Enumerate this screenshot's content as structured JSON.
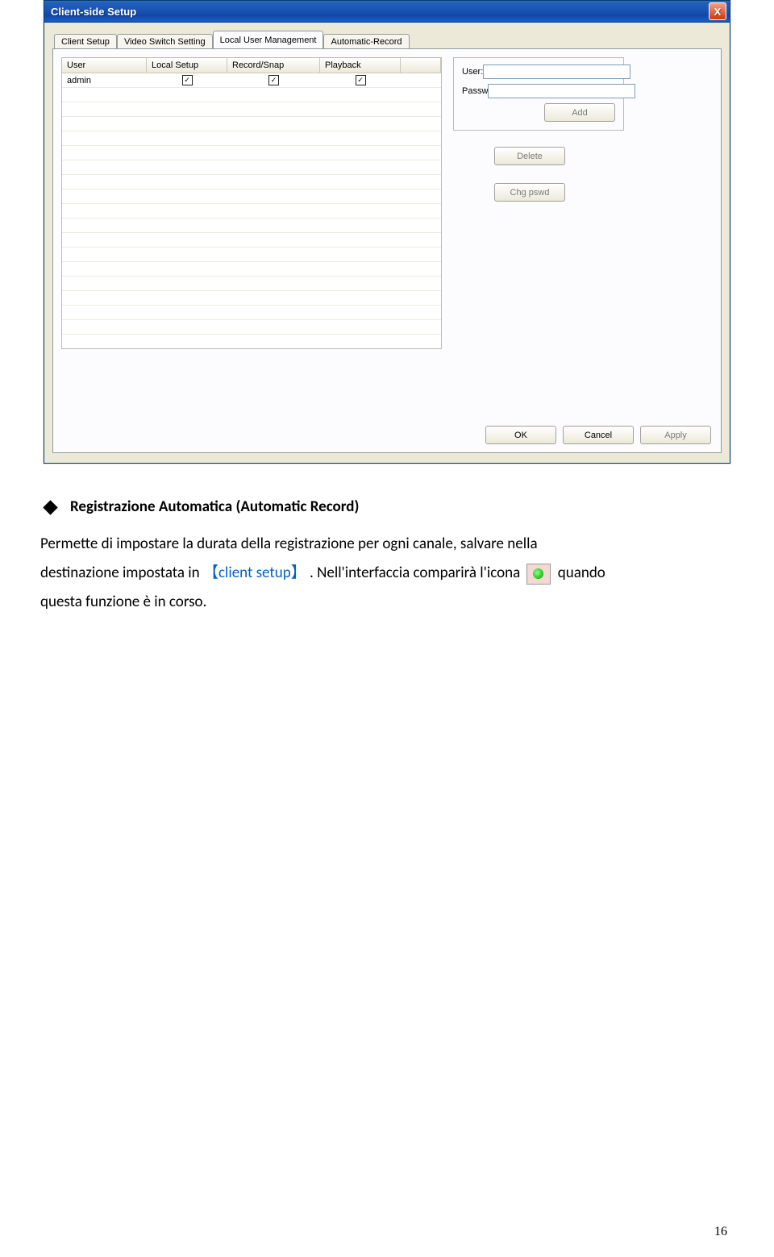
{
  "window": {
    "title": "Client-side Setup",
    "close_label": "X"
  },
  "tabs": {
    "t0": "Client Setup",
    "t1": "Video Switch Setting",
    "t2": "Local User Management",
    "t3": "Automatic-Record"
  },
  "table": {
    "headers": {
      "user": "User",
      "local": "Local Setup",
      "rec": "Record/Snap",
      "play": "Playback"
    },
    "row0": {
      "user": "admin",
      "local_checked": "☑",
      "rec_checked": "☑",
      "play_checked": "☑"
    }
  },
  "form": {
    "user_label": "User:",
    "passw_label": "Passw",
    "add_label": "Add",
    "delete_label": "Delete",
    "chg_label": "Chg pswd"
  },
  "buttons": {
    "ok": "OK",
    "cancel": "Cancel",
    "apply": "Apply"
  },
  "doc": {
    "heading": "Registrazione Automatica (Automatic Record)",
    "p1a": "Permette di impostare la durata della registrazione per ogni canale, salvare nella",
    "p2a": "destinazione impostata in",
    "p2b": "【client setup】",
    "p2c": ". Nell'interfaccia comparirà l'icona",
    "p2d": "quando",
    "p3": "questa funzione è in corso."
  },
  "page_number": "16"
}
